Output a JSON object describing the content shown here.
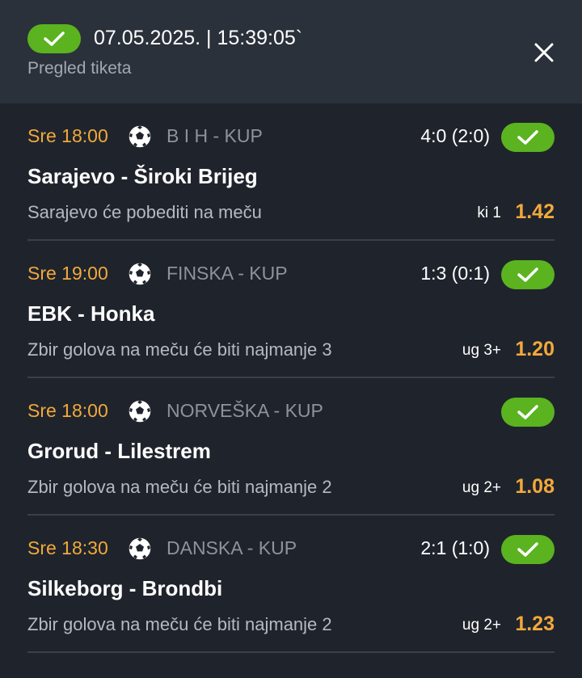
{
  "header": {
    "datetime": "07.05.2025. | 15:39:05`",
    "subtitle": "Pregled tiketa",
    "status_icon": "check-icon",
    "close_icon": "close-icon",
    "accent_color": "#5ab31f"
  },
  "matches": [
    {
      "time": "Sre 18:00",
      "league": "B I H - KUP",
      "score": "4:0 (2:0)",
      "teams": "Sarajevo - Široki Brijeg",
      "pick": "Sarajevo će pobediti na meču",
      "code": "ki 1",
      "odd": "1.42",
      "status": "won"
    },
    {
      "time": "Sre 19:00",
      "league": "FINSKA - KUP",
      "score": "1:3 (0:1)",
      "teams": "EBK - Honka",
      "pick": "Zbir golova na meču će biti najmanje 3",
      "code": "ug 3+",
      "odd": "1.20",
      "status": "won"
    },
    {
      "time": "Sre 18:00",
      "league": "NORVEŠKA - KUP",
      "score": "",
      "teams": "Grorud - Lilestrem",
      "pick": "Zbir golova na meču će biti najmanje 2",
      "code": "ug 2+",
      "odd": "1.08",
      "status": "won"
    },
    {
      "time": "Sre 18:30",
      "league": "DANSKA - KUP",
      "score": "2:1 (1:0)",
      "teams": "Silkeborg - Brondbi",
      "pick": "Zbir golova na meču će biti najmanje 2",
      "code": "ug 2+",
      "odd": "1.23",
      "status": "won"
    }
  ]
}
